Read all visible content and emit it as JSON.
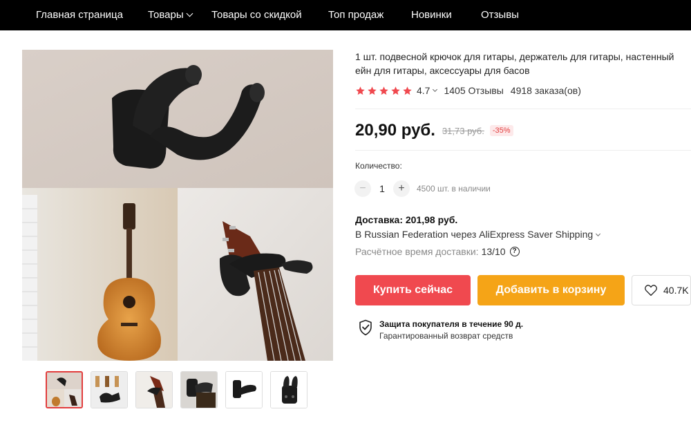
{
  "nav": {
    "items": [
      {
        "label": "Главная страница"
      },
      {
        "label": "Товары"
      },
      {
        "label": "Товары со скидкой"
      },
      {
        "label": "Топ продаж"
      },
      {
        "label": "Новинки"
      },
      {
        "label": "Отзывы"
      }
    ]
  },
  "product": {
    "title": "1 шт. подвесной крючок для гитары, держатель для гитары, настенный ейн для гитары, аксессуары для басов",
    "rating": "4.7",
    "stars": 5,
    "reviews": "1405 Отзывы",
    "orders": "4918 заказа(ов)",
    "price": "20,90 руб.",
    "old_price": "31,73 руб.",
    "discount": "-35%"
  },
  "quantity": {
    "label": "Количество:",
    "minus": "−",
    "value": "1",
    "plus": "+",
    "stock": "4500 шт. в наличии"
  },
  "delivery": {
    "title": "Доставка: 201,98 руб.",
    "via": "В Russian Federation через AliExpress Saver Shipping",
    "time_label": "Расчётное время доставки:",
    "time_value": "13/10",
    "help": "?"
  },
  "actions": {
    "buy": "Купить сейчас",
    "cart": "Добавить в корзину",
    "wishlist_count": "40.7K"
  },
  "protection": {
    "title": "Защита покупателя в течение 90 д.",
    "subtitle": "Гарантированный возврат средств"
  },
  "gallery": {
    "thumb_count": 6,
    "active_thumb": 1
  },
  "colors": {
    "nav_bg": "#000000",
    "buy": "#f0494f",
    "cart": "#f5a417",
    "star": "#f0494f",
    "discount": "#e23c3c"
  }
}
